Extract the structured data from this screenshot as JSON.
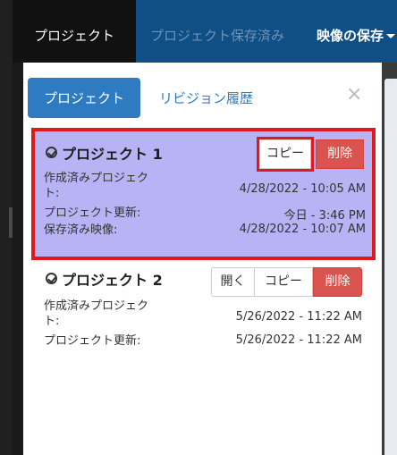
{
  "topbar": {
    "tab_project": "プロジェクト",
    "tab_saved": "プロジェクト保存済み",
    "tab_export": "映像の保存"
  },
  "panel": {
    "project_button": "プロジェクト",
    "revision_link": "リビジョン履歴",
    "close_label": "×"
  },
  "cards": [
    {
      "title": "プロジェクト 1",
      "copy_label": "コピー",
      "delete_label": "削除",
      "created_label": "作成済みプロジェクト:",
      "created_value": "4/28/2022 - 10:05 AM",
      "updated_label": "プロジェクト更新:",
      "updated_value": "今日 - 3:46 PM",
      "saved_label": "保存済み映像:",
      "saved_value": "4/28/2022 - 10:07 AM"
    },
    {
      "title": "プロジェクト 2",
      "open_label": "開く",
      "copy_label": "コピー",
      "delete_label": "削除",
      "created_label": "作成済みプロジェクト:",
      "created_value": "5/26/2022 - 11:22 AM",
      "updated_label": "プロジェクト更新:",
      "updated_value": "5/26/2022 - 11:22 AM"
    }
  ],
  "colors": {
    "topbar_bg": "#0f4f86",
    "primary": "#2f7bc2",
    "selected_card": "#b8b3f4",
    "highlight": "#e0191e",
    "danger": "#d9534f"
  }
}
